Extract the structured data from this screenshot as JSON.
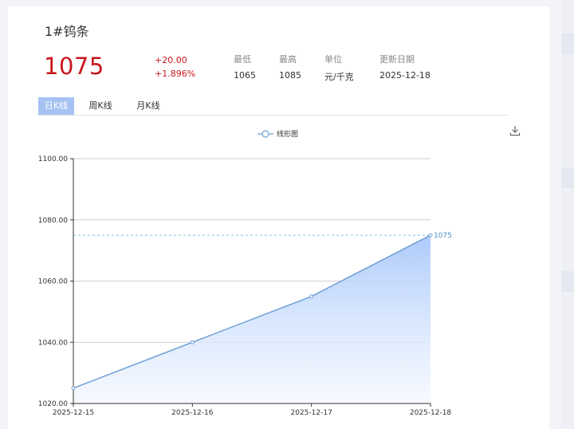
{
  "product": {
    "title": "1#钨条",
    "price": "1075",
    "change": "+20.00",
    "change_pct": "+1.896%"
  },
  "stats": [
    {
      "label": "最低",
      "value": "1065"
    },
    {
      "label": "最高",
      "value": "1085"
    },
    {
      "label": "单位",
      "value": "元/千克"
    },
    {
      "label": "更新日期",
      "value": "2025-12-18"
    }
  ],
  "tabs": [
    {
      "label": "日K线",
      "active": true
    },
    {
      "label": "周K线",
      "active": false
    },
    {
      "label": "月K线",
      "active": false
    }
  ],
  "icons": {
    "download": "download-icon"
  },
  "colors": {
    "price": "#c8171e",
    "line": "#6fa0d6",
    "area_top": "#a9c8fb",
    "area_bottom": "#f1f6ff",
    "tab_active": "#a5c2f3"
  },
  "chart_data": {
    "type": "area",
    "legend": "线形图",
    "legend_position": "top-center",
    "x": [
      "2025-12-15",
      "2025-12-16",
      "2025-12-17",
      "2025-12-18"
    ],
    "series": [
      {
        "name": "线形图",
        "values": [
          1025,
          1040,
          1055,
          1075
        ]
      }
    ],
    "ylim": [
      1020,
      1100
    ],
    "yticks": [
      "1020.00",
      "1040.00",
      "1060.00",
      "1080.00",
      "1100.00"
    ],
    "grid": true,
    "markline": {
      "value": 1075,
      "label": "1075"
    }
  }
}
